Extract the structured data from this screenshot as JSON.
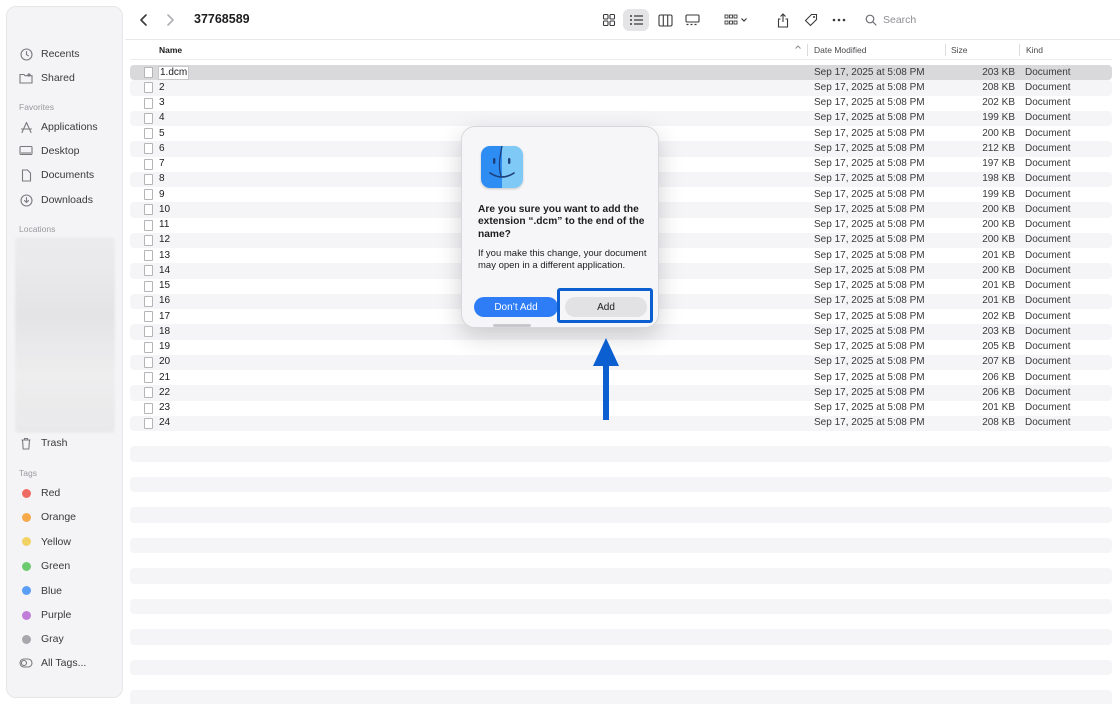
{
  "window": {
    "folder_title": "37768589"
  },
  "sidebar": {
    "items_top": [
      {
        "label": "Recents",
        "icon": "clock-icon"
      },
      {
        "label": "Shared",
        "icon": "shared-folder-icon"
      }
    ],
    "favorites_label": "Favorites",
    "favorites": [
      {
        "label": "Applications",
        "icon": "applications-icon"
      },
      {
        "label": "Desktop",
        "icon": "desktop-icon"
      },
      {
        "label": "Documents",
        "icon": "document-icon"
      },
      {
        "label": "Downloads",
        "icon": "download-icon"
      }
    ],
    "locations_label": "Locations",
    "trash_label": "Trash",
    "tags_label": "Tags",
    "tags": [
      {
        "label": "Red",
        "color": "#ee6b62"
      },
      {
        "label": "Orange",
        "color": "#f5a94a"
      },
      {
        "label": "Yellow",
        "color": "#f3d265"
      },
      {
        "label": "Green",
        "color": "#6ccb6e"
      },
      {
        "label": "Blue",
        "color": "#5a9ff5"
      },
      {
        "label": "Purple",
        "color": "#c07ed9"
      },
      {
        "label": "Gray",
        "color": "#a8a8ac"
      }
    ],
    "all_tags_label": "All Tags..."
  },
  "toolbar": {
    "search_placeholder": "Search"
  },
  "columns": {
    "name": "Name",
    "date": "Date Modified",
    "size": "Size",
    "kind": "Kind"
  },
  "files": [
    {
      "name": "1.dcm",
      "date": "Sep 17, 2025 at 5:08 PM",
      "size": "203 KB",
      "kind": "Document"
    },
    {
      "name": "2",
      "date": "Sep 17, 2025 at 5:08 PM",
      "size": "208 KB",
      "kind": "Document"
    },
    {
      "name": "3",
      "date": "Sep 17, 2025 at 5:08 PM",
      "size": "202 KB",
      "kind": "Document"
    },
    {
      "name": "4",
      "date": "Sep 17, 2025 at 5:08 PM",
      "size": "199 KB",
      "kind": "Document"
    },
    {
      "name": "5",
      "date": "Sep 17, 2025 at 5:08 PM",
      "size": "200 KB",
      "kind": "Document"
    },
    {
      "name": "6",
      "date": "Sep 17, 2025 at 5:08 PM",
      "size": "212 KB",
      "kind": "Document"
    },
    {
      "name": "7",
      "date": "Sep 17, 2025 at 5:08 PM",
      "size": "197 KB",
      "kind": "Document"
    },
    {
      "name": "8",
      "date": "Sep 17, 2025 at 5:08 PM",
      "size": "198 KB",
      "kind": "Document"
    },
    {
      "name": "9",
      "date": "Sep 17, 2025 at 5:08 PM",
      "size": "199 KB",
      "kind": "Document"
    },
    {
      "name": "10",
      "date": "Sep 17, 2025 at 5:08 PM",
      "size": "200 KB",
      "kind": "Document"
    },
    {
      "name": "11",
      "date": "Sep 17, 2025 at 5:08 PM",
      "size": "200 KB",
      "kind": "Document"
    },
    {
      "name": "12",
      "date": "Sep 17, 2025 at 5:08 PM",
      "size": "200 KB",
      "kind": "Document"
    },
    {
      "name": "13",
      "date": "Sep 17, 2025 at 5:08 PM",
      "size": "201 KB",
      "kind": "Document"
    },
    {
      "name": "14",
      "date": "Sep 17, 2025 at 5:08 PM",
      "size": "200 KB",
      "kind": "Document"
    },
    {
      "name": "15",
      "date": "Sep 17, 2025 at 5:08 PM",
      "size": "201 KB",
      "kind": "Document"
    },
    {
      "name": "16",
      "date": "Sep 17, 2025 at 5:08 PM",
      "size": "201 KB",
      "kind": "Document"
    },
    {
      "name": "17",
      "date": "Sep 17, 2025 at 5:08 PM",
      "size": "202 KB",
      "kind": "Document"
    },
    {
      "name": "18",
      "date": "Sep 17, 2025 at 5:08 PM",
      "size": "203 KB",
      "kind": "Document"
    },
    {
      "name": "19",
      "date": "Sep 17, 2025 at 5:08 PM",
      "size": "205 KB",
      "kind": "Document"
    },
    {
      "name": "20",
      "date": "Sep 17, 2025 at 5:08 PM",
      "size": "207 KB",
      "kind": "Document"
    },
    {
      "name": "21",
      "date": "Sep 17, 2025 at 5:08 PM",
      "size": "206 KB",
      "kind": "Document"
    },
    {
      "name": "22",
      "date": "Sep 17, 2025 at 5:08 PM",
      "size": "206 KB",
      "kind": "Document"
    },
    {
      "name": "23",
      "date": "Sep 17, 2025 at 5:08 PM",
      "size": "201 KB",
      "kind": "Document"
    },
    {
      "name": "24",
      "date": "Sep 17, 2025 at 5:08 PM",
      "size": "208 KB",
      "kind": "Document"
    }
  ],
  "dialog": {
    "title": "Are you sure you want to add the extension “.dcm” to the end of the name?",
    "message": "If you make this change, your document may open in a different application.",
    "cancel_label": "Don’t Add",
    "confirm_label": "Add",
    "highlight_color": "#0b5fd0"
  }
}
